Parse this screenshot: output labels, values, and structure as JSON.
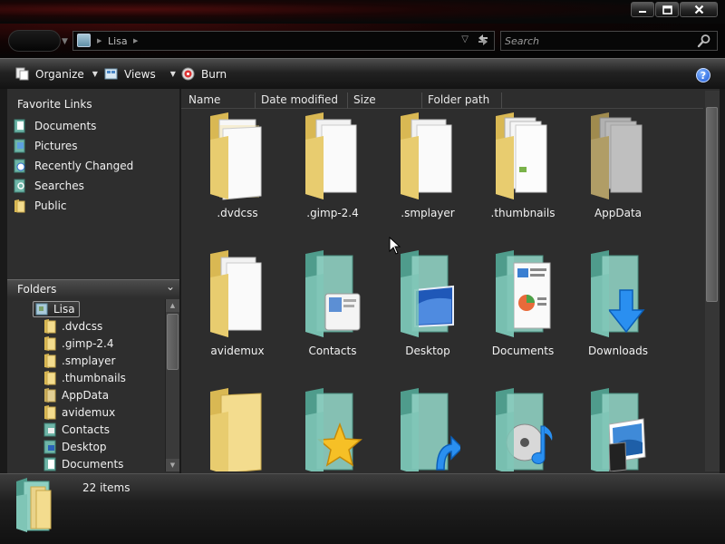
{
  "window": {
    "minimize_icon": "minimize-icon",
    "maximize_icon": "maximize-icon",
    "close_icon": "close-icon"
  },
  "address": {
    "location": "Lisa",
    "search_placeholder": "Search"
  },
  "toolbar": {
    "organize_label": "Organize",
    "views_label": "Views",
    "burn_label": "Burn"
  },
  "favorites": {
    "title": "Favorite Links",
    "items": [
      {
        "label": "Documents",
        "icon": "documents-icon"
      },
      {
        "label": "Pictures",
        "icon": "pictures-icon"
      },
      {
        "label": "Recently Changed",
        "icon": "recent-icon"
      },
      {
        "label": "Searches",
        "icon": "searches-icon"
      },
      {
        "label": "Public",
        "icon": "public-folder-icon"
      }
    ]
  },
  "folders": {
    "title": "Folders",
    "root": "Lisa",
    "items": [
      ".dvdcss",
      ".gimp-2.4",
      ".smplayer",
      ".thumbnails",
      "AppData",
      "avidemux",
      "Contacts",
      "Desktop",
      "Documents"
    ]
  },
  "columns": [
    "Name",
    "Date modified",
    "Size",
    "Folder path"
  ],
  "files": [
    {
      "label": ".dvdcss",
      "kind": "folder"
    },
    {
      "label": ".gimp-2.4",
      "kind": "folder"
    },
    {
      "label": ".smplayer",
      "kind": "folder"
    },
    {
      "label": ".thumbnails",
      "kind": "folder"
    },
    {
      "label": "AppData",
      "kind": "folder-hidden"
    },
    {
      "label": "avidemux",
      "kind": "folder"
    },
    {
      "label": "Contacts",
      "kind": "contacts-folder"
    },
    {
      "label": "Desktop",
      "kind": "desktop-folder"
    },
    {
      "label": "Documents",
      "kind": "documents-folder"
    },
    {
      "label": "Downloads",
      "kind": "downloads-folder"
    },
    {
      "label": "",
      "kind": "folder"
    },
    {
      "label": "",
      "kind": "favorites-folder"
    },
    {
      "label": "",
      "kind": "links-folder"
    },
    {
      "label": "",
      "kind": "music-folder"
    },
    {
      "label": "",
      "kind": "pictures-folder"
    }
  ],
  "status": {
    "item_count": "22 items"
  },
  "colors": {
    "frame_red": "#4a0c0c",
    "pane_bg": "#2d2d2d",
    "folder_yellow": "#f3dc8e",
    "special_folder_teal": "#6fb6a8"
  }
}
